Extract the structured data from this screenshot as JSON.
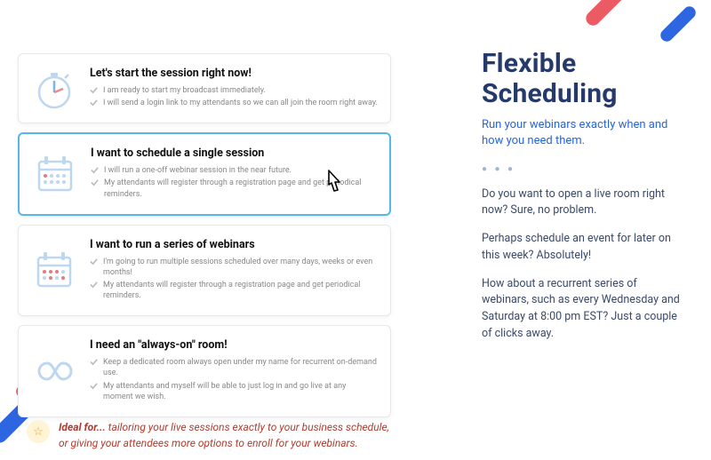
{
  "options": [
    {
      "title": "Let's start the session right now!",
      "b1": "I am ready to start my broadcast immediately.",
      "b2": "I will send a login link to my attendants so we can all join the room right away."
    },
    {
      "title": "I want to schedule a single session",
      "b1": "I will run a one-off webinar session in the near future.",
      "b2": "My attendants will register through a registration page and get periodical reminders."
    },
    {
      "title": "I want to run a series of webinars",
      "b1": "I'm going to run multiple sessions scheduled over many days, weeks or even months!",
      "b2": "My attendants will register through a registration page and get periodical reminders."
    },
    {
      "title": "I need an \"always-on\" room!",
      "b1": "Keep a dedicated room always open under my name for recurrent on-demand use.",
      "b2": "My attendants and myself will be able to just log in and go live at any moment we wish."
    }
  ],
  "right": {
    "heading": "Flexible Scheduling",
    "subheading": "Run your webinars exactly when and how you need them.",
    "p1": "Do you want to open a live room right now? Sure, no problem.",
    "p2": "Perhaps schedule an event for later on this week? Absolutely!",
    "p3": "How about a recurrent series of webinars, such as every Wednesday and Saturday at 8:00 pm EST? Just a couple of clicks away."
  },
  "ideal": {
    "label": "Ideal for... ",
    "text": "tailoring your live sessions exactly to your business schedule, or  giving your attendees more options to enroll for your webinars."
  },
  "colors": {
    "accent_blue": "#2566dd",
    "accent_red": "#ec5a63",
    "heading_navy": "#253a6b",
    "select_border": "#57b7e8"
  }
}
